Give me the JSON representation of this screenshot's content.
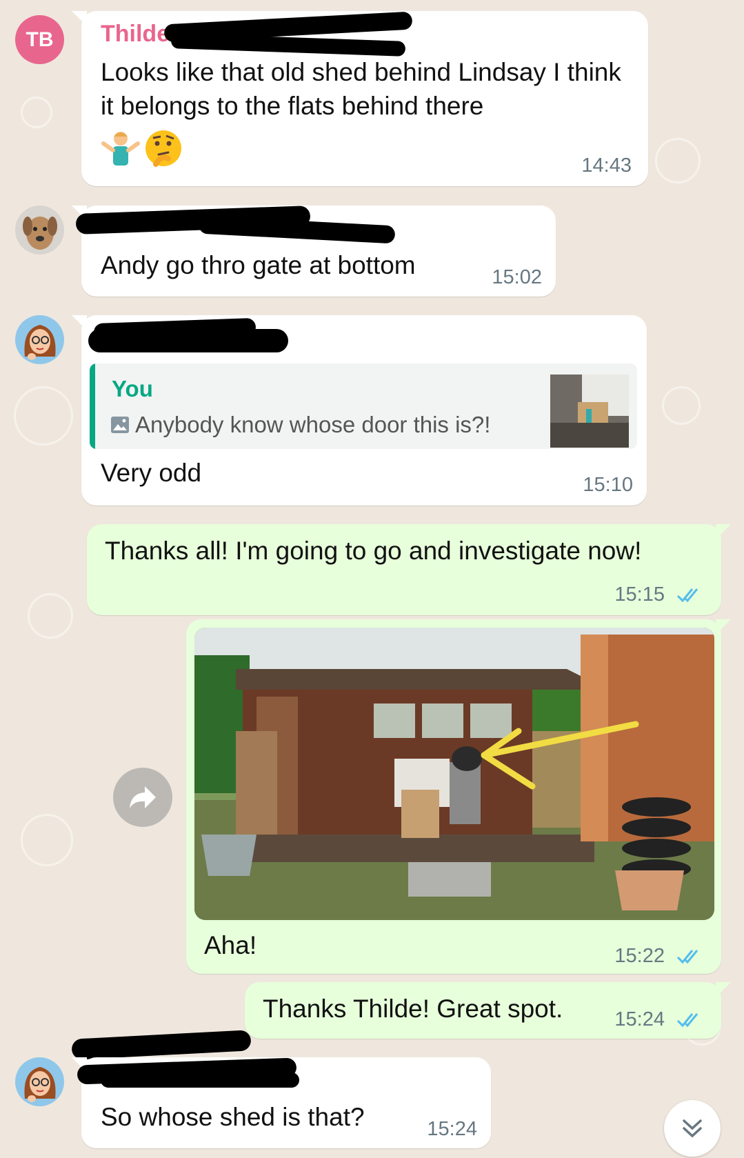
{
  "messages": [
    {
      "sender": "Thilde",
      "avatar_initials": "TB",
      "avatar_color": "#e8668e",
      "text": "Looks like that old shed behind Lindsay I think it belongs to the flats behind there",
      "emoji": [
        "person-shrugging",
        "thinking-face"
      ],
      "time": "14:43"
    },
    {
      "text": "Andy go thro gate at bottom",
      "time": "15:02"
    },
    {
      "quote_author": "You",
      "quote_text": "Anybody know whose door this is?!",
      "text": "Very odd",
      "time": "15:10"
    },
    {
      "text": "Thanks all! I'm going to go and investigate now!",
      "time": "15:15"
    },
    {
      "caption": "Aha!",
      "time": "15:22"
    },
    {
      "text": "Thanks Thilde! Great spot.",
      "time": "15:24"
    },
    {
      "text": "So whose shed is that?",
      "time": "15:24"
    }
  ],
  "colors": {
    "background": "#efe7dd",
    "incoming_bubble": "#ffffff",
    "outgoing_bubble": "#e7ffdb",
    "sender_pink": "#e8668e",
    "quote_green": "#06a884",
    "read_ticks": "#53bdeb"
  }
}
